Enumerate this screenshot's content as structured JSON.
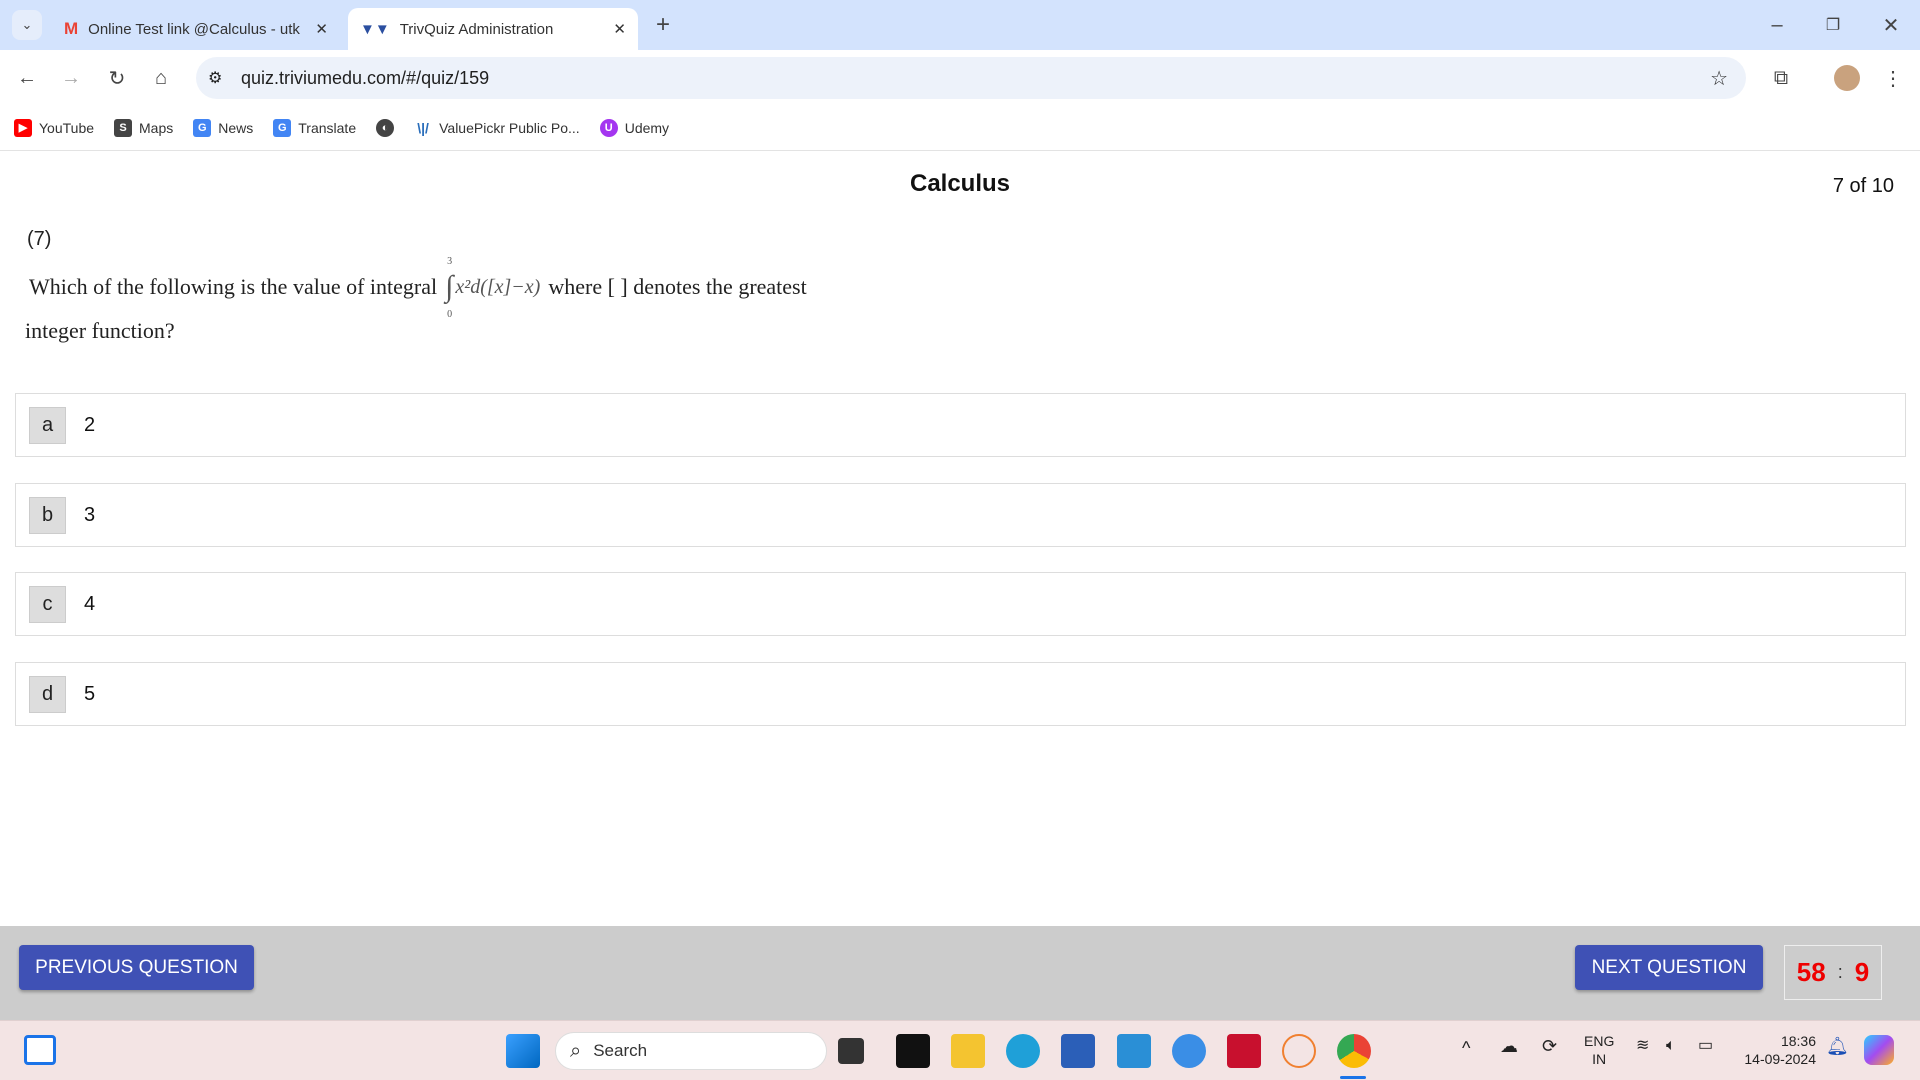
{
  "browser": {
    "tabs": [
      {
        "title": "Online Test link @Calculus - utk",
        "icon": "gmail-icon",
        "active": false
      },
      {
        "title": "TrivQuiz Administration",
        "icon": "trivquiz-icon",
        "active": true
      }
    ],
    "url": "quiz.triviumedu.com/#/quiz/159",
    "bookmarks": [
      {
        "label": "YouTube",
        "icon": "youtube-icon",
        "color": "#ff0000"
      },
      {
        "label": "Maps",
        "icon": "maps-icon",
        "color": "#444444"
      },
      {
        "label": "News",
        "icon": "news-icon",
        "color": "#4285f4"
      },
      {
        "label": "Translate",
        "icon": "translate-icon",
        "color": "#4285f4"
      },
      {
        "label": "",
        "icon": "globe-icon",
        "color": "#444444"
      },
      {
        "label": "ValuePickr Public Po...",
        "icon": "valuepickr-icon",
        "color": "#2a6ebb"
      },
      {
        "label": "Udemy",
        "icon": "udemy-icon",
        "color": "#a435f0"
      }
    ]
  },
  "quiz": {
    "title": "Calculus",
    "counter": "7 of 10",
    "question_number": "(7)",
    "question_before": "Which of the following is the value of integral",
    "integral": {
      "upper": "3",
      "lower": "0",
      "integrand": "x²d([x]−x)"
    },
    "question_after": "where [ ] denotes the greatest",
    "question_line2": "integer function?",
    "options": [
      {
        "label": "a",
        "value": "2"
      },
      {
        "label": "b",
        "value": "3"
      },
      {
        "label": "c",
        "value": "4"
      },
      {
        "label": "d",
        "value": "5"
      }
    ],
    "prev_label": "PREVIOUS QUESTION",
    "next_label": "NEXT QUESTION",
    "timer": {
      "minutes": "58",
      "sep": ":",
      "seconds": "9"
    },
    "accent": "#3f51b5",
    "timer_color": "#ee0000"
  },
  "taskbar": {
    "search_placeholder": "Search",
    "lang1": "ENG",
    "lang2": "IN",
    "time": "18:36",
    "date": "14-09-2024"
  }
}
